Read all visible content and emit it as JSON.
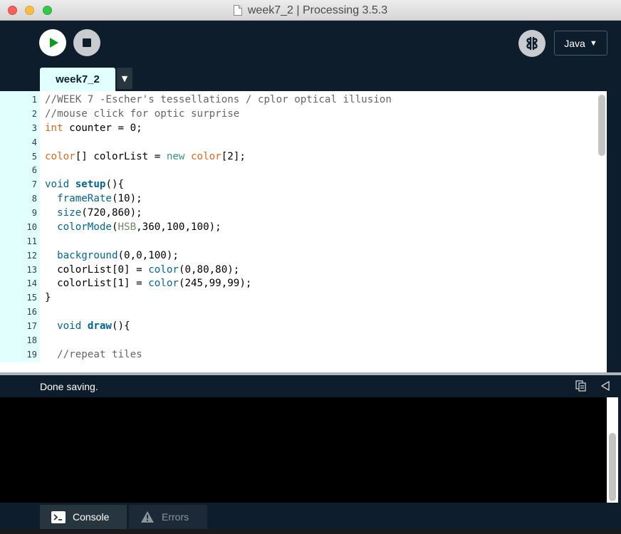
{
  "window": {
    "title": "week7_2 | Processing 3.5.3"
  },
  "toolbar": {
    "run_icon": "play-icon",
    "stop_icon": "stop-icon",
    "debug_icon": "butterfly-debugger-icon",
    "mode": "Java",
    "mode_caret": "▼"
  },
  "tabs": {
    "active": "week7_2",
    "menu_caret": "▼"
  },
  "editor": {
    "line_numbers": [
      "1",
      "2",
      "3",
      "4",
      "5",
      "6",
      "7",
      "8",
      "9",
      "10",
      "11",
      "12",
      "13",
      "14",
      "15",
      "16",
      "17",
      "18",
      "19"
    ],
    "lines": [
      "//WEEK 7 -Escher's tessellations / cplor optical illusion",
      "//mouse click for optic surprise",
      "int counter = 0;",
      "",
      "color[] colorList = new color[2];",
      "",
      "void setup(){",
      "  frameRate(10);",
      "  size(720,860);",
      "  colorMode(HSB,360,100,100);",
      "",
      "  background(0,0,100);",
      "  colorList[0] = color(0,80,80);",
      "  colorList[1] = color(245,99,99);",
      "}",
      "",
      "  void draw(){",
      "",
      "  //repeat tiles"
    ]
  },
  "status": {
    "message": "Done saving."
  },
  "footer": {
    "console_label": "Console",
    "errors_label": "Errors"
  },
  "colors": {
    "chrome": "#0d1d2c",
    "gutter": "#e0fffd",
    "comment": "#666666",
    "type": "#e2661a",
    "keyword": "#33997e",
    "function": "#006699",
    "constant": "#718a62"
  }
}
